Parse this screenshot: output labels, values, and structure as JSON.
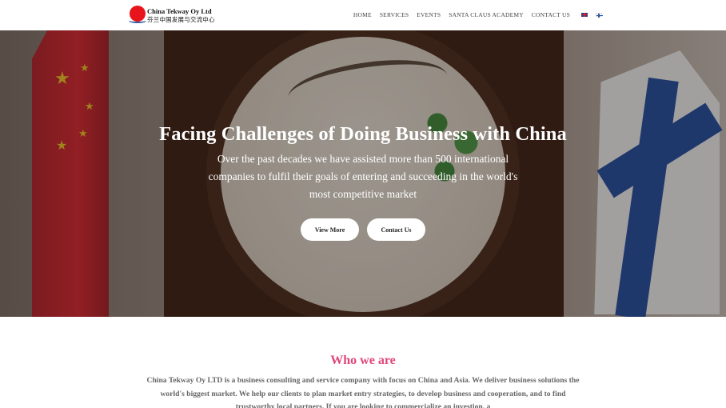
{
  "brand": {
    "name_en": "China Tekway Oy Ltd",
    "name_cn": "芬兰中国发展与交流中心"
  },
  "nav": {
    "items": [
      "HOME",
      "SERVICES",
      "EVENTS",
      "SANTA CLAUS ACADEMY",
      "CONTACT US"
    ],
    "languages": [
      "english-flag-icon",
      "finnish-flag-icon"
    ]
  },
  "hero": {
    "title": "Facing Challenges of Doing Business with China",
    "subtitle": "Over the past decades we have assisted more than 500 international companies to fulfil their goals of entering and succeeding in the world's most competitive market",
    "buttons": {
      "view_more": "View More",
      "contact_us": "Contact Us"
    }
  },
  "about": {
    "title": "Who we are",
    "text": "China Tekway Oy LTD is a business consulting and service company with focus on China and Asia. We deliver business solutions the world's biggest market. We help our clients to plan market entry strategies, to develop business and cooperation, and to find trustworthy local partners. If you are looking to commercialize an investion, a"
  },
  "colors": {
    "accent": "#e0457b",
    "logo_red": "#e8141b"
  }
}
